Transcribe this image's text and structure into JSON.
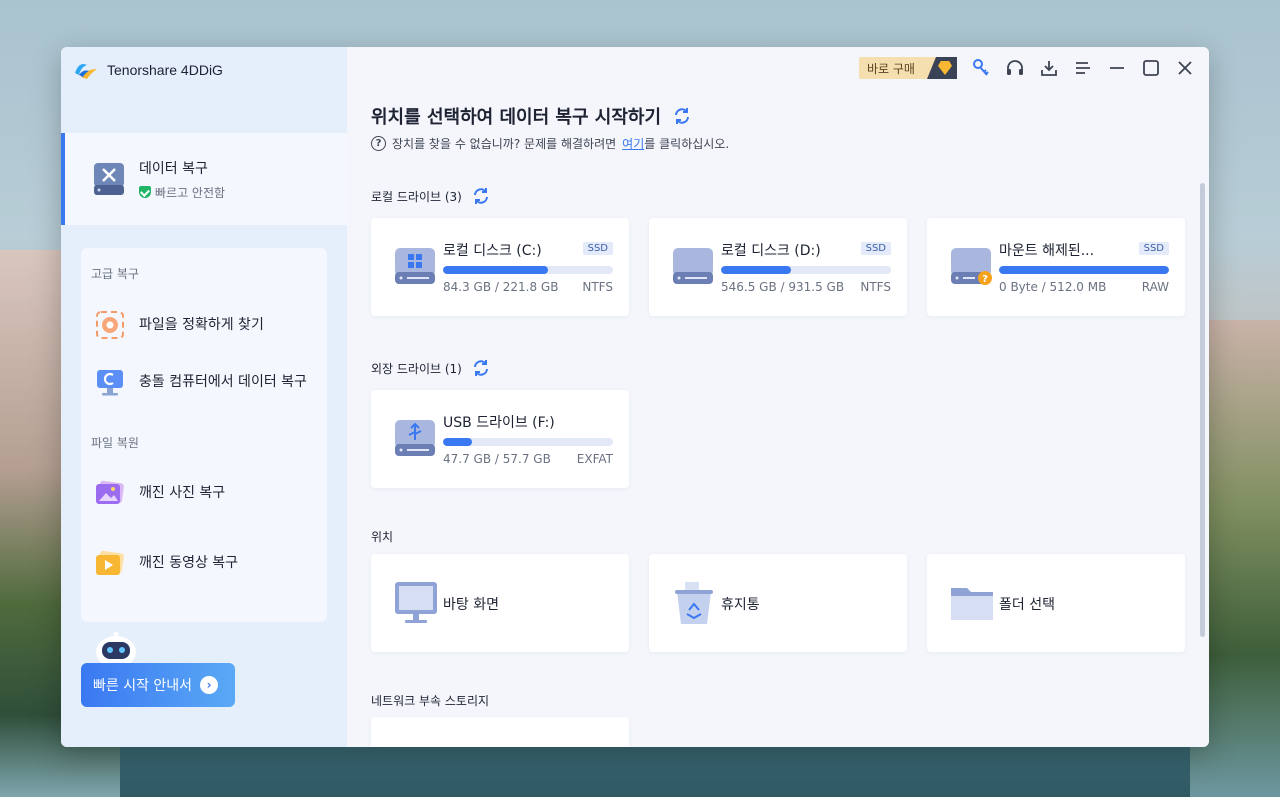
{
  "app": {
    "name": "Tenorshare 4DDiG"
  },
  "sidebar": {
    "active_item": {
      "title": "데이터 복구",
      "subtitle": "빠르고 안전함"
    },
    "advanced_label": "고급 복구",
    "advanced_items": [
      {
        "label": "파일을 정확하게 찾기"
      },
      {
        "label": "충돌 컴퓨터에서 데이터 복구"
      }
    ],
    "repair_label": "파일 복원",
    "repair_items": [
      {
        "label": "깨진 사진 복구"
      },
      {
        "label": "깨진 동영상 복구"
      }
    ],
    "guide_button": "빠른 시작 안내서"
  },
  "topbar": {
    "buy_label": "바로 구매"
  },
  "main": {
    "heading": "위치를 선택하여 데이터 복구 시작하기",
    "subhead_prefix": "장치를 찾을 수 없습니까? 문제를 해결하려면",
    "subhead_link": "여기",
    "subhead_suffix": "를 클릭하십시오.",
    "local_label": "로컬 드라이브 (3)",
    "local_drives": [
      {
        "name": "로컬 디스크 (C:)",
        "badge": "SSD",
        "size": "84.3 GB / 221.8 GB",
        "fs": "NTFS",
        "used": 0.62
      },
      {
        "name": "로컬 디스크 (D:)",
        "badge": "SSD",
        "size": "546.5 GB / 931.5 GB",
        "fs": "NTFS",
        "used": 0.41
      },
      {
        "name": "마운트 해제된...",
        "badge": "SSD",
        "size": "0 Byte / 512.0 MB",
        "fs": "RAW",
        "used": 1.0
      }
    ],
    "external_label": "외장 드라이브 (1)",
    "external_drives": [
      {
        "name": "USB 드라이브 (F:)",
        "size": "47.7 GB / 57.7 GB",
        "fs": "EXFAT",
        "used": 0.17
      }
    ],
    "location_label": "위치",
    "locations": [
      {
        "name": "바탕 화면"
      },
      {
        "name": "휴지통"
      },
      {
        "name": "폴더 선택"
      }
    ],
    "network_label": "네트워크 부속 스토리지"
  },
  "colors": {
    "accent": "#3a78f2",
    "sidebar_bg": "#e5eefb",
    "main_bg": "#f4f6fb"
  }
}
